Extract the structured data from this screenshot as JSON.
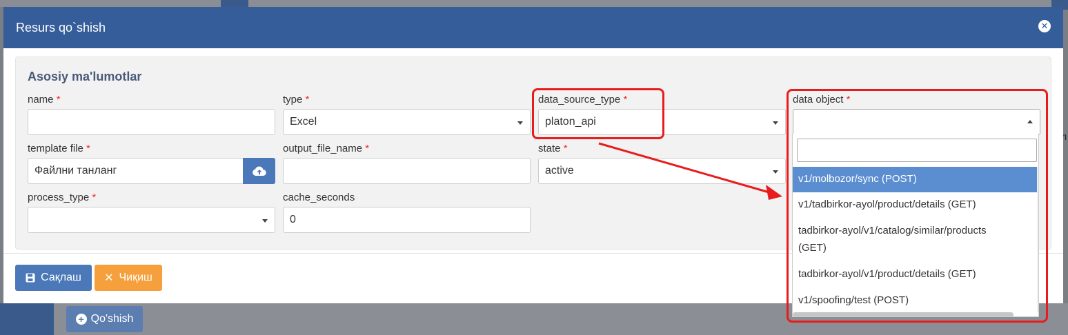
{
  "modal": {
    "title": "Resurs qo`shish",
    "section_title": "Asosiy ma'lumotlar"
  },
  "fields": {
    "name": {
      "label": "name",
      "value": ""
    },
    "type": {
      "label": "type",
      "value": "Excel"
    },
    "data_source_type": {
      "label": "data_source_type",
      "value": "platon_api"
    },
    "data_object": {
      "label": "data object",
      "value": ""
    },
    "template_file": {
      "label": "template file",
      "value": "Файлни танланг"
    },
    "output_file_name": {
      "label": "output_file_name",
      "value": ""
    },
    "state": {
      "label": "state",
      "value": "active"
    },
    "process_type": {
      "label": "process_type",
      "value": ""
    },
    "cache_seconds": {
      "label": "cache_seconds",
      "value": "0"
    }
  },
  "required_mark": "*",
  "dropdown": {
    "items": [
      "v1/molbozor/sync (POST)",
      "v1/tadbirkor-ayol/product/details (GET)",
      "tadbirkor-ayol/v1/catalog/similar/products",
      "(GET)",
      "tadbirkor-ayol/v1/product/details (GET)",
      "v1/spoofing/test (POST)"
    ],
    "active_index": 0
  },
  "footer": {
    "save_label": "Сақлаш",
    "exit_label": "Чиқиш"
  },
  "background": {
    "add_button_label": "Qo'shish",
    "right_text": "л"
  },
  "colors": {
    "header": "#345d9a",
    "primary": "#4b78b8",
    "warning": "#f5a03c",
    "annotation": "#e81c1c"
  }
}
